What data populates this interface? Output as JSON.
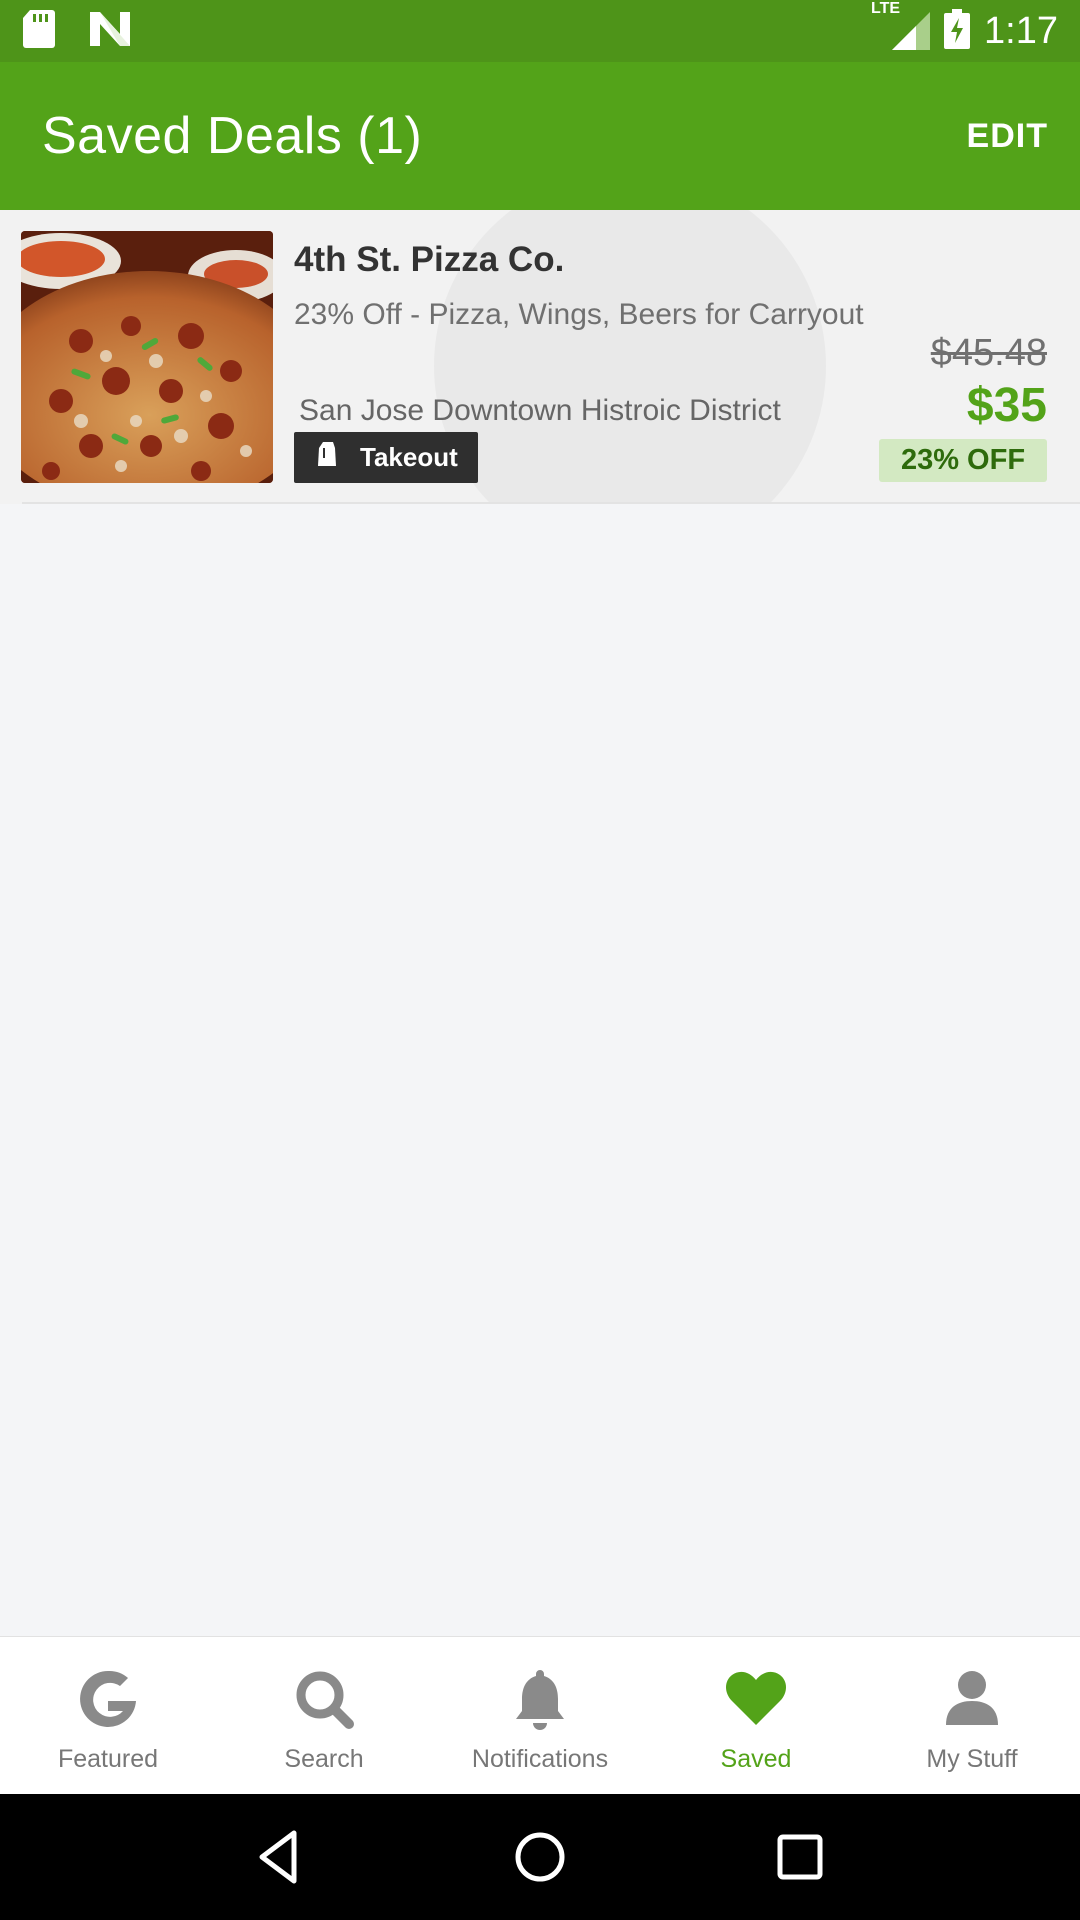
{
  "status_bar": {
    "time": "1:17",
    "network": "LTE",
    "icons": [
      "sd-card-icon",
      "n-logo-icon",
      "lte-signal-icon",
      "battery-charging-icon"
    ]
  },
  "header": {
    "title": "Saved Deals (1)",
    "edit_label": "EDIT"
  },
  "deals": [
    {
      "name": "4th St. Pizza Co.",
      "description": "23% Off - Pizza, Wings, Beers for Carryout",
      "location": "San Jose Downtown Histroic District",
      "badge": "Takeout",
      "original_price": "$45.48",
      "price": "$35",
      "discount": "23% OFF"
    }
  ],
  "bottom_nav": {
    "items": [
      {
        "label": "Featured",
        "icon": "groupon-g-icon",
        "active": false
      },
      {
        "label": "Search",
        "icon": "search-icon",
        "active": false
      },
      {
        "label": "Notifications",
        "icon": "bell-icon",
        "active": false
      },
      {
        "label": "Saved",
        "icon": "heart-icon",
        "active": true
      },
      {
        "label": "My Stuff",
        "icon": "person-icon",
        "active": false
      }
    ]
  },
  "colors": {
    "status_bar": "#4e9419",
    "app_bar": "#53a319",
    "accent_green": "#53a319",
    "discount_badge_bg": "#d3e9c2",
    "inactive_icon": "#8a8a8a"
  }
}
